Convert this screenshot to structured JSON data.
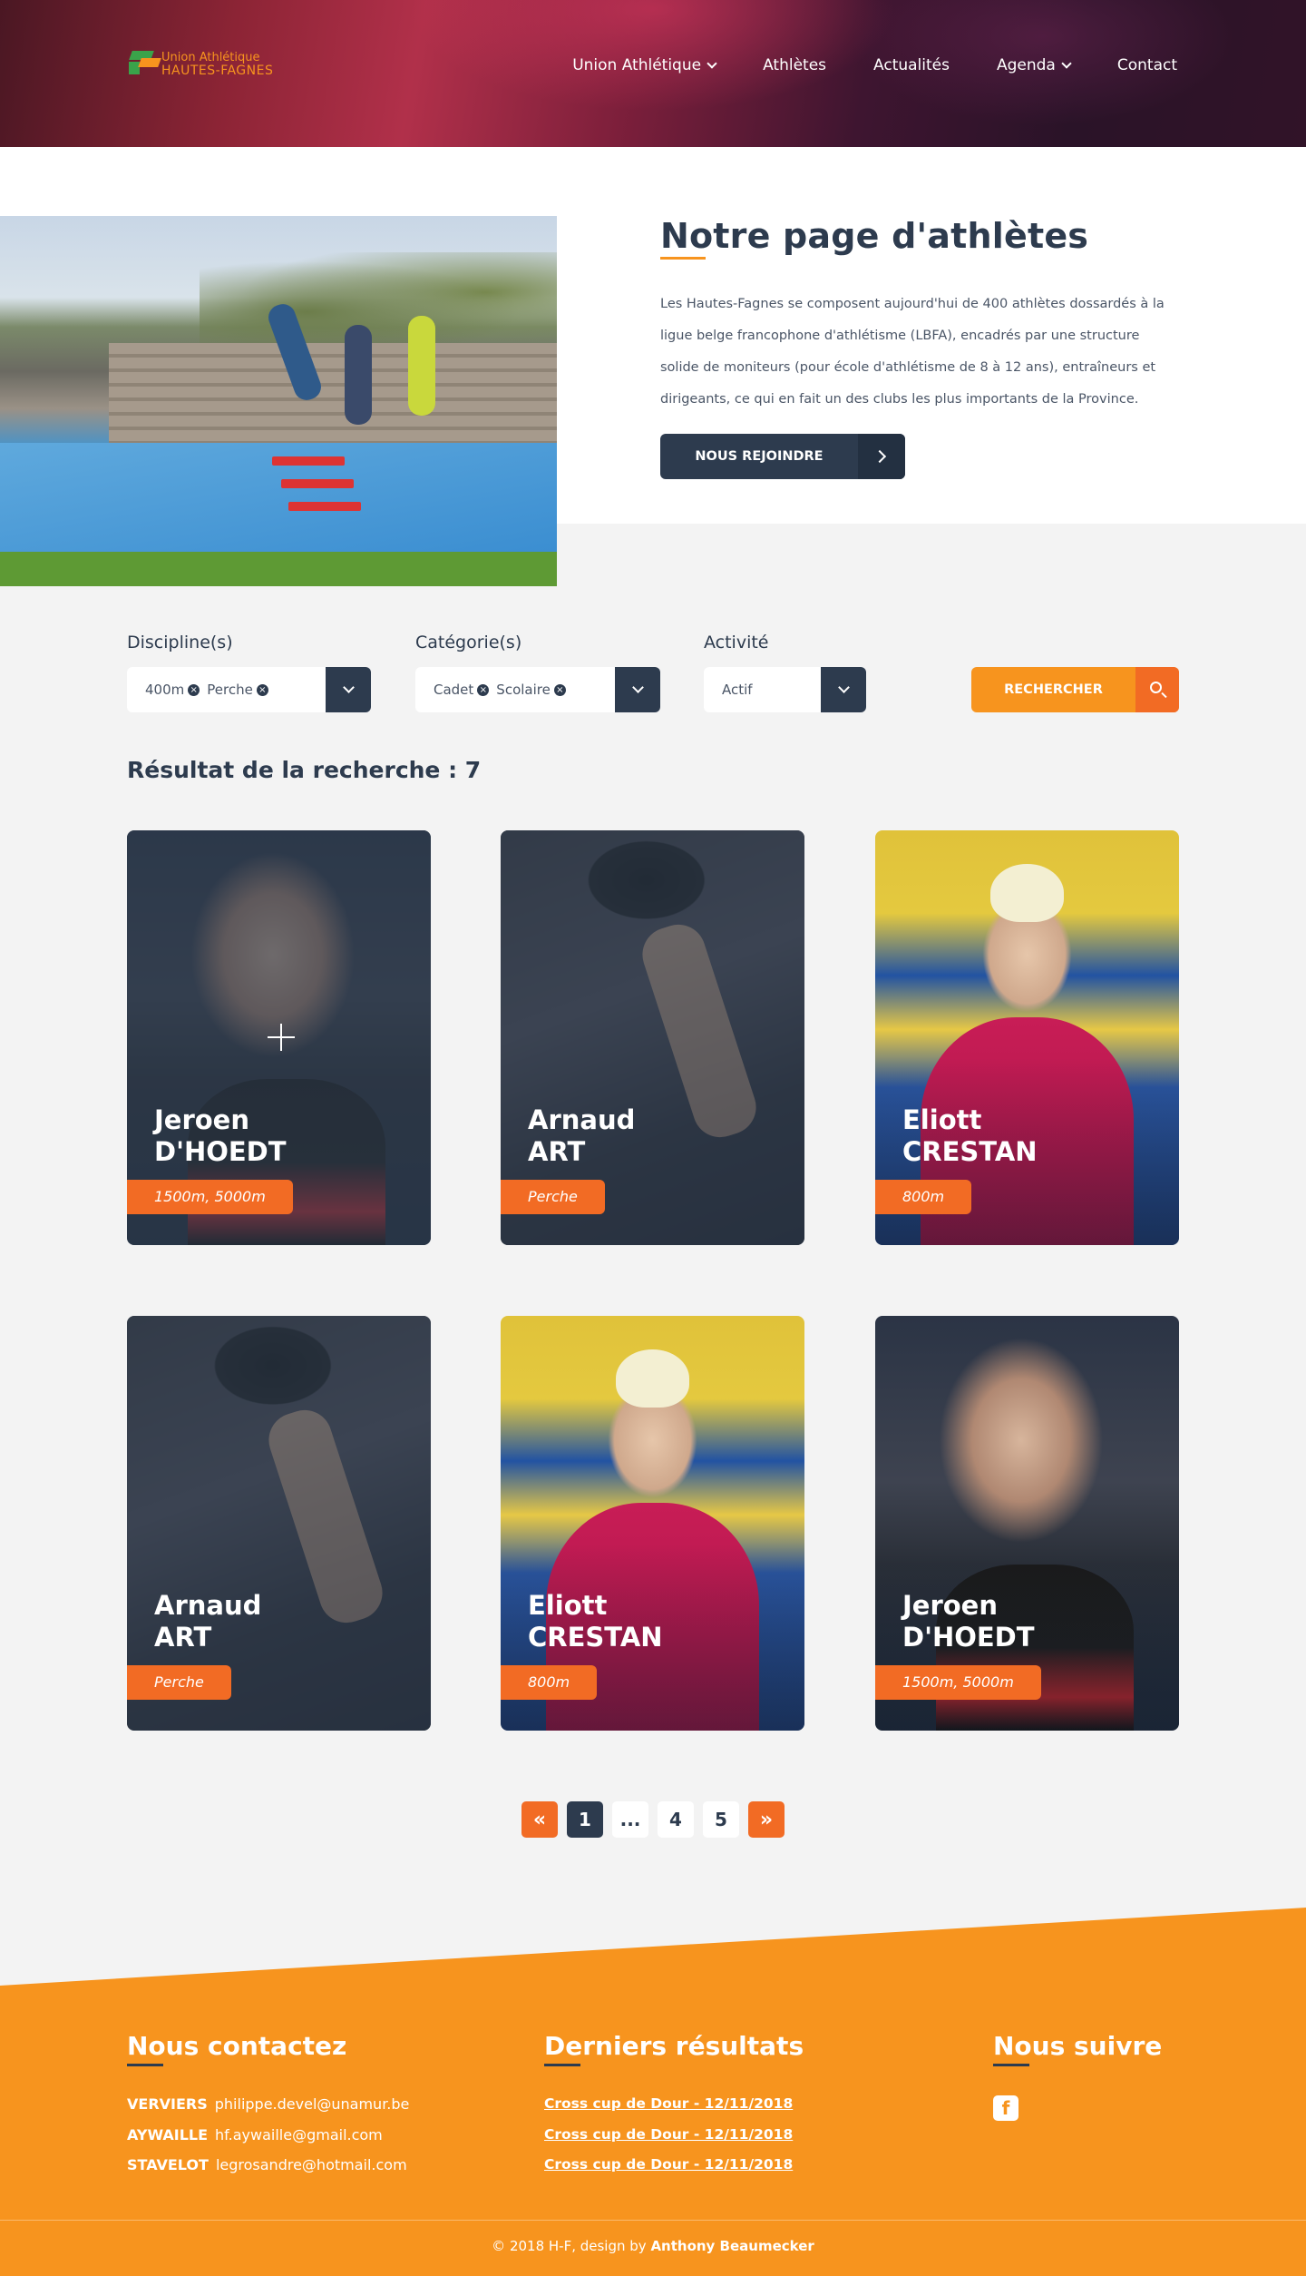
{
  "header": {
    "logo_line1": "Union Athlétique",
    "logo_line2": "HAUTES-FAGNES",
    "nav": [
      "Union Athlétique",
      "Athlètes",
      "Actualités",
      "Agenda",
      "Contact"
    ]
  },
  "intro": {
    "title": "Notre page d'athlètes",
    "text": "Les Hautes-Fagnes se composent aujourd'hui de 400 athlètes dossardés à la ligue belge francophone d'athlétisme (LBFA), encadrés par une structure solide de moniteurs (pour école d'athlétisme de 8 à 12 ans), entraîneurs et dirigeants, ce qui en fait un des clubs les plus importants de la Province.",
    "join_label": "NOUS REJOINDRE"
  },
  "filters": {
    "discipline_label": "Discipline(s)",
    "discipline_tags": [
      "400m",
      "Perche"
    ],
    "category_label": "Catégorie(s)",
    "category_tags": [
      "Cadet",
      "Scolaire"
    ],
    "activity_label": "Activité",
    "activity_value": "Actif",
    "search_label": "RECHERCHER"
  },
  "results_label": "Résultat de la recherche : 7",
  "athletes": [
    {
      "first": "Jeroen",
      "last": "D'HOEDT",
      "disciplines": "1500m, 5000m"
    },
    {
      "first": "Arnaud",
      "last": "ART",
      "disciplines": "Perche"
    },
    {
      "first": "Eliott",
      "last": "CRESTAN",
      "disciplines": "800m"
    },
    {
      "first": "Arnaud",
      "last": "ART",
      "disciplines": "Perche"
    },
    {
      "first": "Eliott",
      "last": "CRESTAN",
      "disciplines": "800m"
    },
    {
      "first": "Jeroen",
      "last": "D'HOEDT",
      "disciplines": "1500m, 5000m"
    }
  ],
  "pagination": {
    "prev": "«",
    "pages": [
      "1",
      "...",
      "4",
      "5"
    ],
    "next": "»"
  },
  "footer": {
    "contact_title": "Nous contactez",
    "contacts": [
      {
        "city": "VERVIERS",
        "email": "philippe.devel@unamur.be"
      },
      {
        "city": "AYWAILLE",
        "email": "hf.aywaille@gmail.com"
      },
      {
        "city": "STAVELOT",
        "email": "legrosandre@hotmail.com"
      }
    ],
    "results_title": "Derniers résultats",
    "results": [
      "Cross cup de Dour - 12/11/2018",
      "Cross cup de Dour - 12/11/2018",
      "Cross cup de Dour - 12/11/2018"
    ],
    "follow_title": "Nous suivre",
    "facebook_icon": "facebook-icon",
    "copyright_prefix": "© 2018 H-F, design by ",
    "copyright_author": "Anthony Beaumecker"
  }
}
